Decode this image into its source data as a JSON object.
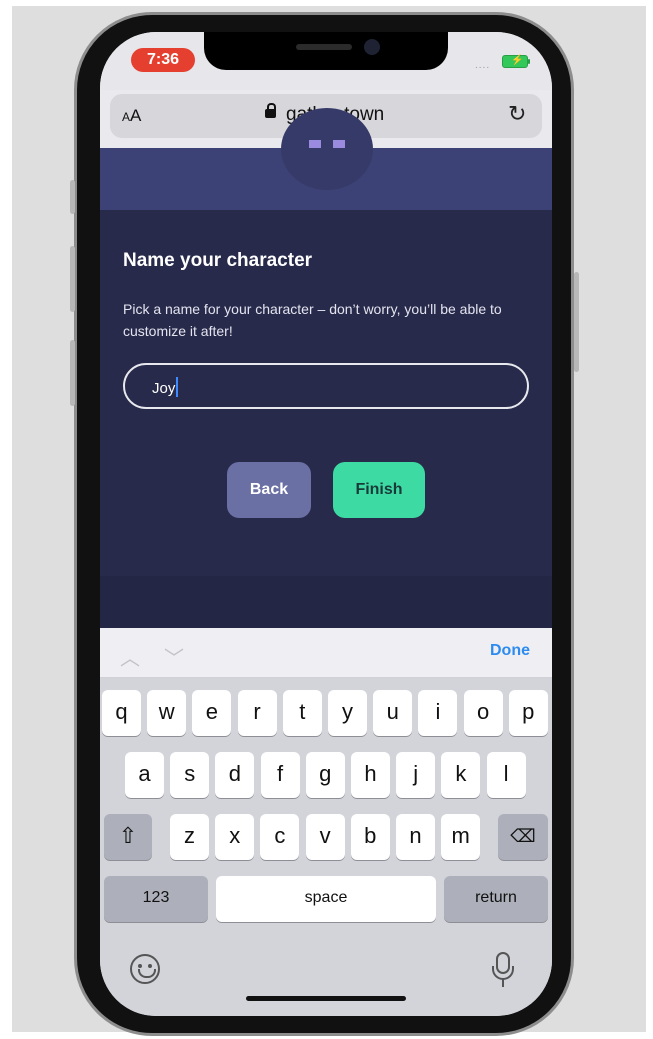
{
  "status_bar": {
    "time": "7:36",
    "signal": "....",
    "battery_icon": "battery-charging-icon"
  },
  "browser": {
    "text_size_label_small": "A",
    "text_size_label_large": "A",
    "url": "gather.town",
    "reload_icon": "reload-icon",
    "lock_icon": "lock-icon"
  },
  "dialog": {
    "title": "Name your character",
    "description": "Pick a name for your character – don’t worry, you’ll be able to customize it after!",
    "name_input": {
      "value": "Joy"
    },
    "back_label": "Back",
    "finish_label": "Finish"
  },
  "keyboard_toolbar": {
    "prev_glyph": "︿",
    "next_glyph": "﹀",
    "done_label": "Done"
  },
  "keyboard": {
    "row1": [
      "q",
      "w",
      "e",
      "r",
      "t",
      "y",
      "u",
      "i",
      "o",
      "p"
    ],
    "row2": [
      "a",
      "s",
      "d",
      "f",
      "g",
      "h",
      "j",
      "k",
      "l"
    ],
    "row3": [
      "z",
      "x",
      "c",
      "v",
      "b",
      "n",
      "m"
    ],
    "shift_icon": "shift-icon",
    "delete_icon": "delete-icon",
    "numbers_label": "123",
    "space_label": "space",
    "return_label": "return",
    "emoji_icon": "emoji-icon",
    "mic_icon": "microphone-icon"
  },
  "colors": {
    "page_bg": "#272a4a",
    "accent_green": "#3ddba3",
    "back_button": "#6a6fa4",
    "done_blue": "#2d8bf0",
    "time_pill": "#e5402f"
  }
}
